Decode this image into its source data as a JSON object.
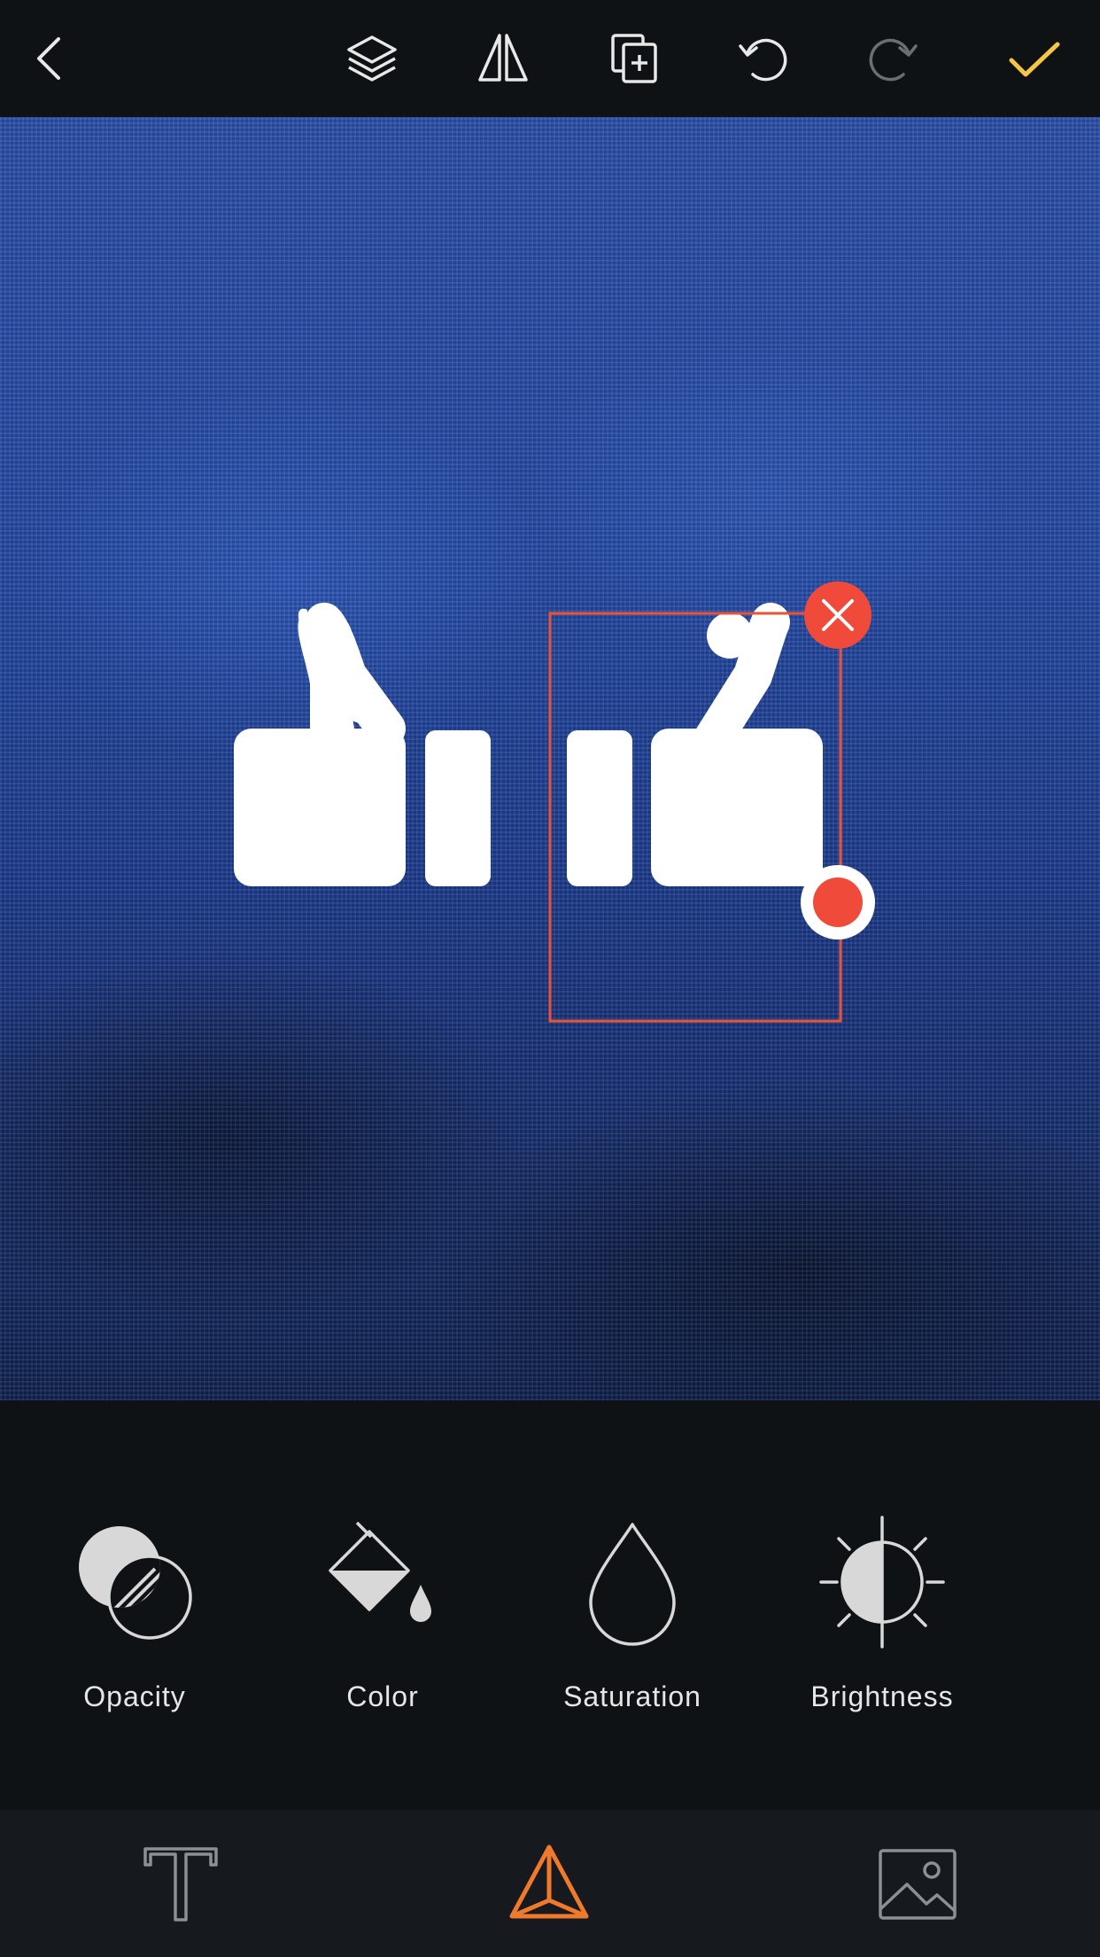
{
  "colors": {
    "background": "#0f1215",
    "bottom_bar": "#16191d",
    "accent_check": "#f6c543",
    "selection": "#e8533a",
    "active_tab": "#f07a2b",
    "icon": "#d8d8d8",
    "icon_disabled": "#6b6f74"
  },
  "toolbar": {
    "items": [
      {
        "name": "back",
        "icon": "chevron-left-icon"
      },
      {
        "name": "layers",
        "icon": "layers-icon"
      },
      {
        "name": "flip",
        "icon": "flip-icon"
      },
      {
        "name": "duplicate",
        "icon": "duplicate-icon"
      },
      {
        "name": "undo",
        "icon": "undo-icon"
      },
      {
        "name": "redo",
        "icon": "redo-icon",
        "disabled": true
      },
      {
        "name": "done",
        "icon": "check-icon"
      }
    ]
  },
  "canvas": {
    "background": "blue fabric texture",
    "stickers": [
      {
        "icon": "thumbs-up-icon",
        "mirrored": true,
        "selected": false
      },
      {
        "icon": "thumbs-up-icon",
        "mirrored": false,
        "selected": true
      }
    ]
  },
  "tools": [
    {
      "label": "Opacity",
      "icon": "opacity-icon"
    },
    {
      "label": "Color",
      "icon": "paint-bucket-icon"
    },
    {
      "label": "Saturation",
      "icon": "drop-icon"
    },
    {
      "label": "Brightness",
      "icon": "brightness-icon"
    }
  ],
  "tabs": [
    {
      "name": "text",
      "icon": "text-icon",
      "active": false
    },
    {
      "name": "shapes",
      "icon": "triangle-icon",
      "active": true
    },
    {
      "name": "image",
      "icon": "image-icon",
      "active": false
    }
  ]
}
